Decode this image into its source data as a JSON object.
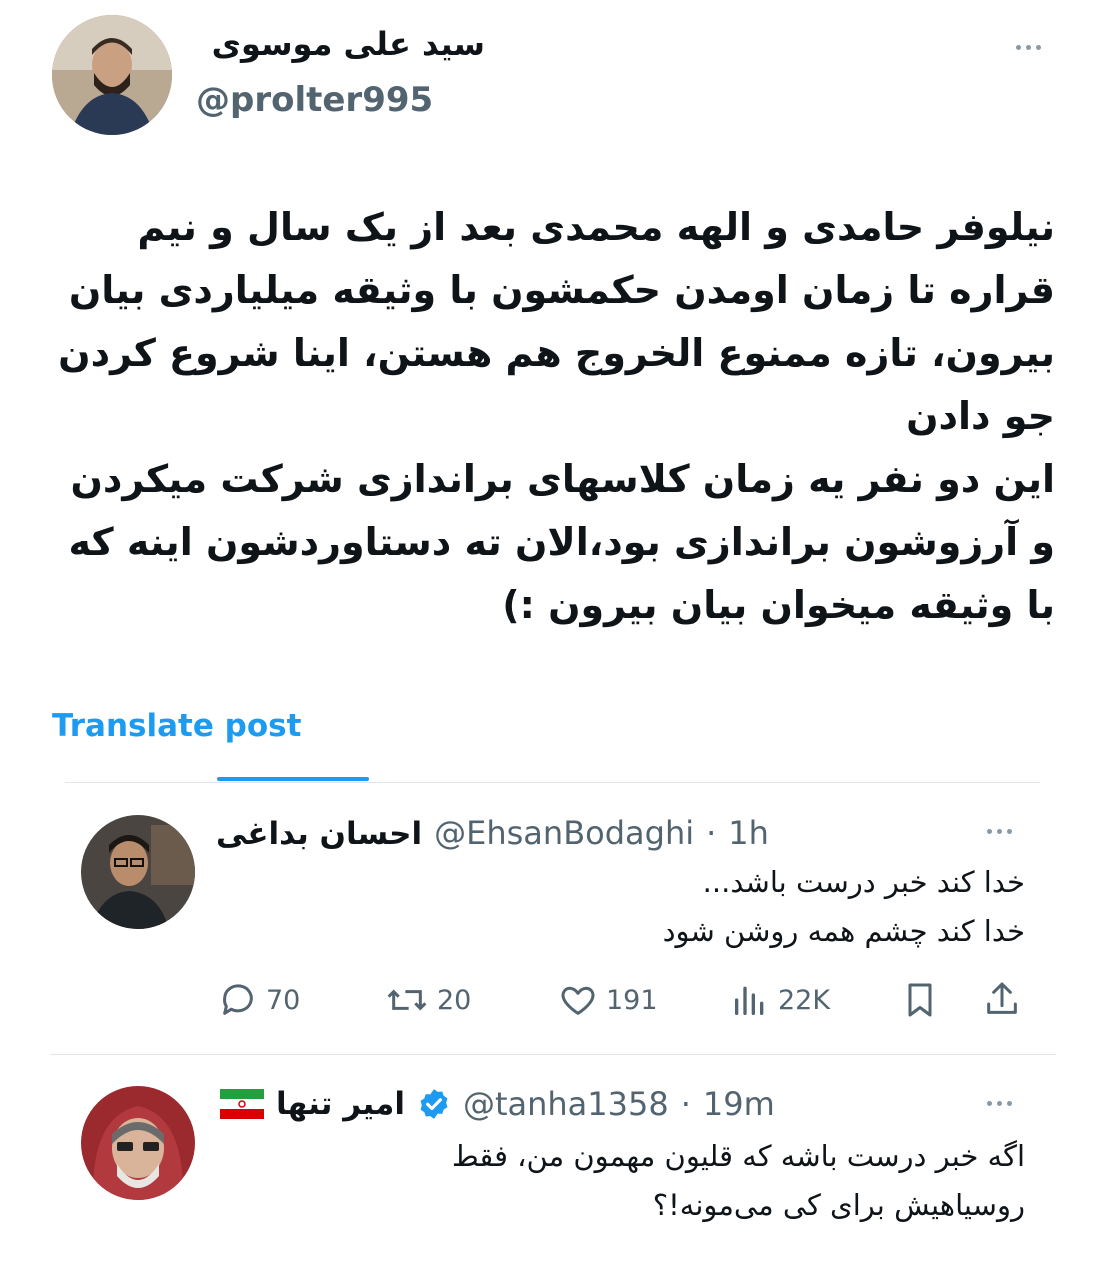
{
  "post": {
    "author_name": "سید علی موسوی",
    "author_handle": "@prolter995",
    "paragraphs": [
      "نیلوفر حامدی و الهه محمدی بعد از یک سال و نیم قراره تا زمان اومدن حکمشون با وثیقه میلیاردی بیان بیرون، تازه ممنوع الخروج هم هستن، اینا شروع کردن جو دادن",
      "این دو نفر یه زمان کلاسهای براندازی شرکت میکردن و آرزوشون براندازی بود،الان ته دستاوردشون اینه که با وثیقه میخوان بیان بیرون :)"
    ],
    "translate_label": "Translate post",
    "icons": {
      "more": "more-icon"
    }
  },
  "replies": [
    {
      "name": "احسان بداغی",
      "handle": "@EhsanBodaghi",
      "time": "1h",
      "lines": [
        "خدا کند خبر درست باشد...",
        "خدا کند چشم همه روشن شود"
      ],
      "actions": {
        "replies": "70",
        "reposts": "20",
        "likes": "191",
        "views": "22K"
      }
    },
    {
      "name": "امیر تنها",
      "handle": "@tanha1358",
      "time": "19m",
      "verified": true,
      "flag": "iran-flag",
      "lines": [
        "اگه خبر درست باشه که قلیون مهمون من، فقط",
        "روسیاهیش برای کی می‌مونه!؟"
      ]
    }
  ],
  "colors": {
    "accent": "#1d9bf0",
    "muted": "#536471",
    "text": "#0f1419"
  }
}
